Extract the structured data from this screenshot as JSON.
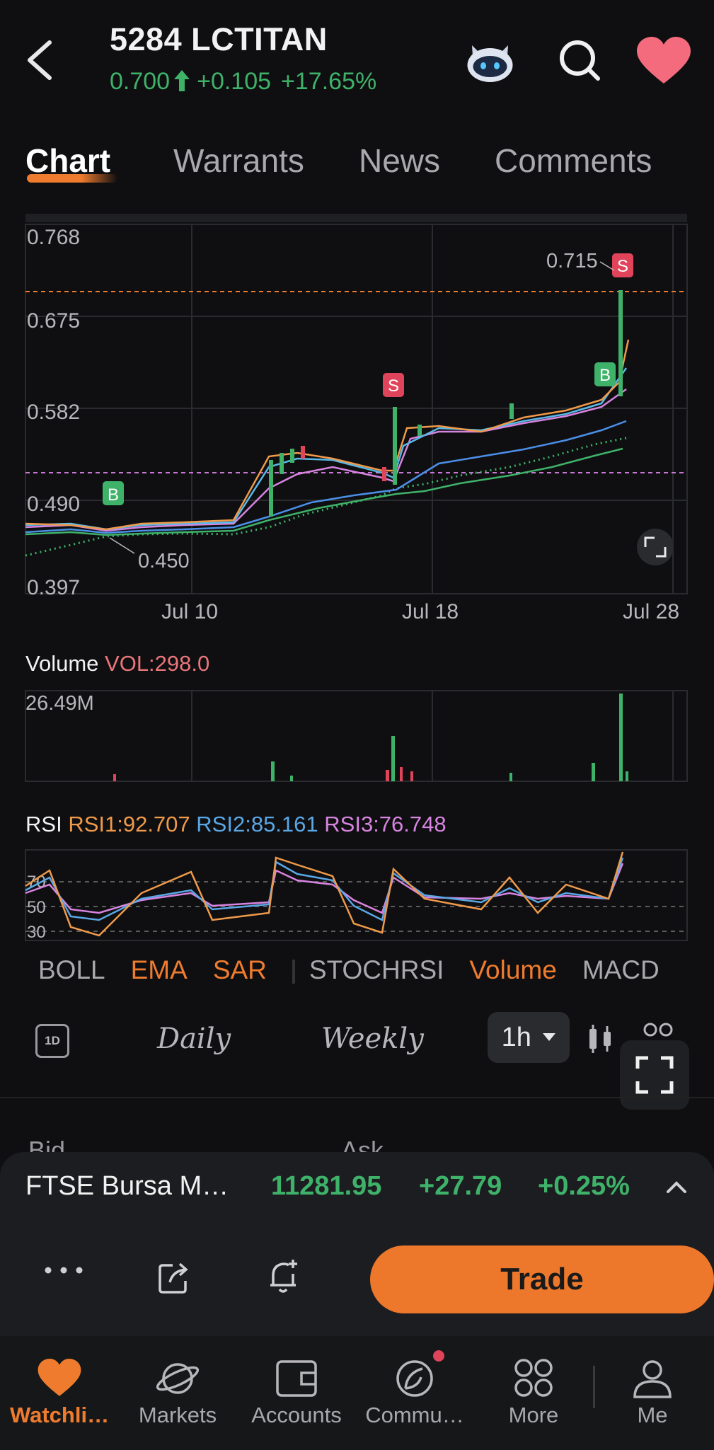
{
  "header": {
    "title": "5284  LCTITAN",
    "price": "0.700",
    "change": "+0.105",
    "change_pct": "+17.65%"
  },
  "tabs": [
    "Chart",
    "Warrants",
    "News",
    "Comments"
  ],
  "main_chart": {
    "y_ticks": [
      "0.768",
      "0.675",
      "0.582",
      "0.490",
      "0.397"
    ],
    "x_ticks": [
      "Jul 10",
      "Jul 18",
      "Jul 28"
    ],
    "high_label": "0.715",
    "low_label": "0.450",
    "signals": [
      "B",
      "S",
      "B",
      "S"
    ]
  },
  "volume": {
    "label": "Volume",
    "value": "VOL:298.0",
    "max_label": "26.49M"
  },
  "rsi": {
    "label": "RSI",
    "rsi1": "RSI1:92.707",
    "rsi2": "RSI2:85.161",
    "rsi3": "RSI3:76.748",
    "levels": [
      "70",
      "50",
      "30"
    ]
  },
  "indicators": [
    {
      "label": "BOLL",
      "active": false
    },
    {
      "label": "EMA",
      "active": true
    },
    {
      "label": "SAR",
      "active": true
    },
    {
      "label": "STOCHRSI",
      "active": false
    },
    {
      "label": "Volume",
      "active": true
    },
    {
      "label": "MACD",
      "active": false
    }
  ],
  "periods": {
    "icon": "1D",
    "daily": "Daily",
    "weekly": "Weekly",
    "selected": "1h"
  },
  "bid_ask": {
    "bid": "Bid",
    "ask": "Ask"
  },
  "index_bar": {
    "name": "FTSE Bursa M…",
    "price": "11281.95",
    "change": "+27.79",
    "change_pct": "+0.25%"
  },
  "actions": {
    "trade": "Trade"
  },
  "bottom_nav": [
    {
      "label": "Watchli…",
      "icon": "heart-icon"
    },
    {
      "label": "Markets",
      "icon": "planet-icon"
    },
    {
      "label": "Accounts",
      "icon": "wallet-icon"
    },
    {
      "label": "Commu…",
      "icon": "community-icon"
    },
    {
      "label": "More",
      "icon": "grid-icon"
    },
    {
      "label": "Me",
      "icon": "person-icon"
    }
  ],
  "colors": {
    "background": "#0f0f11",
    "up": "#3fb26a",
    "down": "#e0445a",
    "accent": "#ef7c2e",
    "rsi1": "#ef9a4a",
    "rsi2": "#5aa7e6",
    "rsi3": "#d784e0"
  }
}
